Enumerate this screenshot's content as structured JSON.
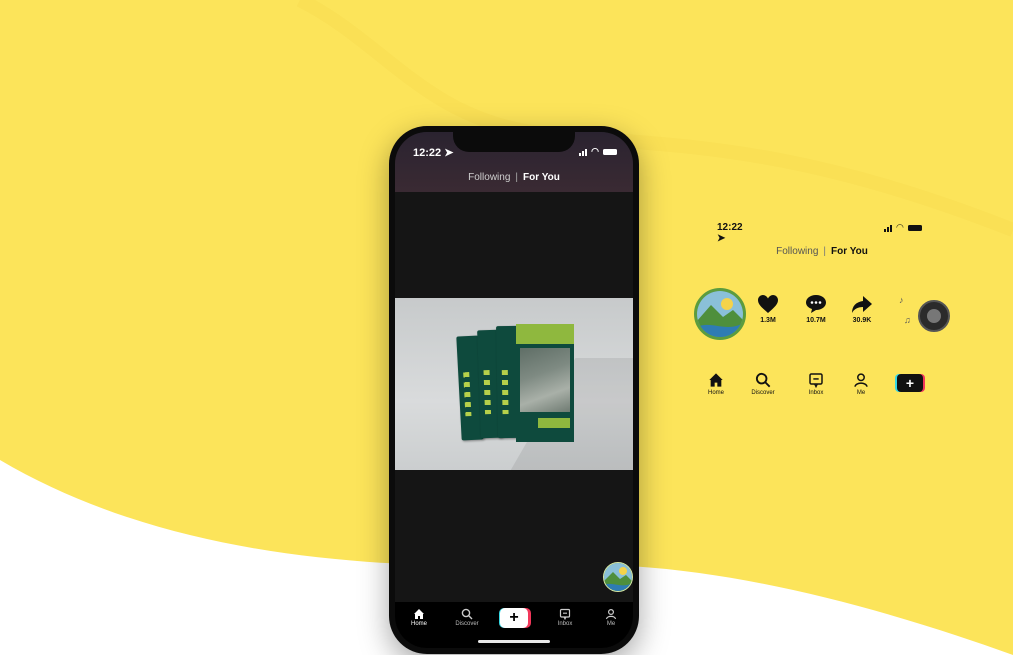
{
  "colors": {
    "background_yellow": "#fce45a",
    "tiktok_cyan": "#36d8e4",
    "tiktok_pink": "#f2375a",
    "book_green": "#0e4a3d",
    "lime": "#8fb83e"
  },
  "phone": {
    "status_time": "12:22",
    "feed_tabs": {
      "following": "Following",
      "separator": "|",
      "for_you": "For You"
    },
    "tabbar": {
      "home": "Home",
      "discover": "Discover",
      "inbox": "Inbox",
      "me": "Me"
    }
  },
  "sheet": {
    "status_time": "12:22",
    "feed_tabs": {
      "following": "Following",
      "separator": "|",
      "for_you": "For You"
    },
    "actions": {
      "likes": "1.3M",
      "comments": "10.7M",
      "shares": "30.9K"
    },
    "nav": {
      "home": "Home",
      "discover": "Discover",
      "inbox": "Inbox",
      "me": "Me"
    }
  }
}
